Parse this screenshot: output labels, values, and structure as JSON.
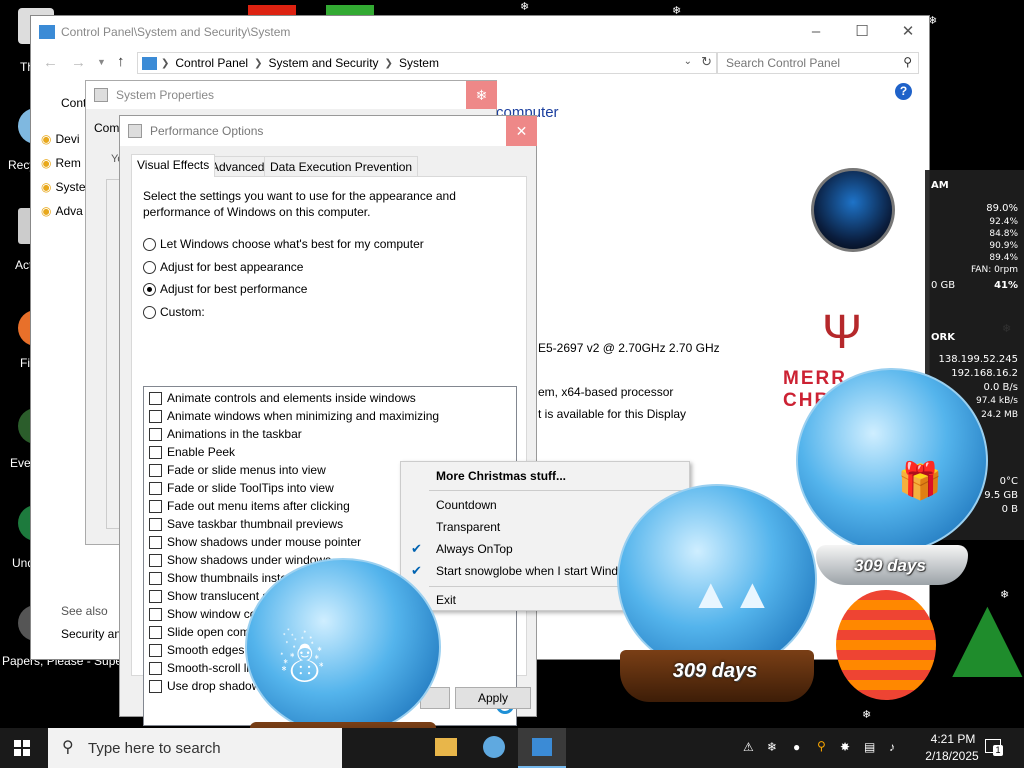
{
  "desktop": {
    "icon_labels": [
      "Th",
      "Recy",
      "Act",
      "Fi",
      "Ever",
      "Und",
      "Papers, Please - Super"
    ]
  },
  "control_panel": {
    "title": "Control Panel\\System and Security\\System",
    "breadcrumbs": [
      "Control Panel",
      "System and Security",
      "System"
    ],
    "search_placeholder": "Search Control Panel",
    "left_home": "Cont",
    "left_links": [
      "Devi",
      "Rem",
      "Syste",
      "Adva"
    ],
    "header_text": "computer",
    "cpu_text": "E5-2697 v2 @ 2.70GHz   2.70 GHz",
    "systype_text": "em, x64-based processor",
    "pen_text": "t is available for this Display",
    "see_also": "See also",
    "see_also_link": "Security and",
    "christmas_text": "MERR CHR"
  },
  "system_properties": {
    "title": "System Properties",
    "tab_partial": "Com",
    "body_partial": "Yo"
  },
  "performance_options": {
    "title": "Performance Options",
    "tabs": [
      "Visual Effects",
      "Advanced",
      "Data Execution Prevention"
    ],
    "description": "Select the settings you want to use for the appearance and performance of Windows on this computer.",
    "radios": [
      {
        "label": "Let Windows choose what's best for my computer",
        "selected": false
      },
      {
        "label": "Adjust for best appearance",
        "selected": false
      },
      {
        "label": "Adjust for best performance",
        "selected": true
      },
      {
        "label": "Custom:",
        "selected": false
      }
    ],
    "effects": [
      "Animate controls and elements inside windows",
      "Animate windows when minimizing and maximizing",
      "Animations in the taskbar",
      "Enable Peek",
      "Fade or slide menus into view",
      "Fade or slide ToolTips into view",
      "Fade out menu items after clicking",
      "Save taskbar thumbnail previews",
      "Show shadows under mouse pointer",
      "Show shadows under windows",
      "Show thumbnails instead of icons",
      "Show translucent selection rectangle",
      "Show window contents while dragging",
      "Slide open combo boxes",
      "Smooth edges of scre",
      "Smooth-scroll list",
      "Use drop shadow"
    ],
    "apply_label": "Apply"
  },
  "context_menu": {
    "items": [
      {
        "label": "More Christmas stuff...",
        "bold": true,
        "checked": false,
        "submenu": false
      },
      {
        "label": "Countdown",
        "bold": false,
        "checked": false,
        "submenu": true
      },
      {
        "label": "Transparent",
        "bold": false,
        "checked": false,
        "submenu": true
      },
      {
        "label": "Always OnTop",
        "bold": false,
        "checked": true,
        "submenu": false
      },
      {
        "label": "Start snowglobe when I start Windows",
        "bold": false,
        "checked": true,
        "submenu": false
      },
      {
        "label": "Exit",
        "bold": false,
        "checked": false,
        "submenu": false
      }
    ]
  },
  "sysmon": {
    "ram_label": "AM",
    "values": [
      "89.0%",
      "92.4%",
      "84.8%",
      "90.9%",
      "89.4%",
      "FAN: 0rpm"
    ],
    "disk": [
      "0 GB",
      "41%"
    ],
    "net_label": "ORK",
    "ips": [
      "138.199.52.245",
      "192.168.16.2"
    ],
    "rates": [
      "0.0 B/s",
      "97.4 kB/s",
      "24.2 MB"
    ],
    "temp": "0°C",
    "storage": "9.5 GB",
    "storage2": "0 B"
  },
  "snowglobes": {
    "days_label": "309 days"
  },
  "taskbar": {
    "search_placeholder": "Type here to search",
    "time": "4:21 PM",
    "date": "2/18/2025",
    "notification_count": "1"
  },
  "colors": {
    "accent": "#0063b1",
    "link": "#1a3e9e",
    "taskbar": "#1a1a1a"
  }
}
